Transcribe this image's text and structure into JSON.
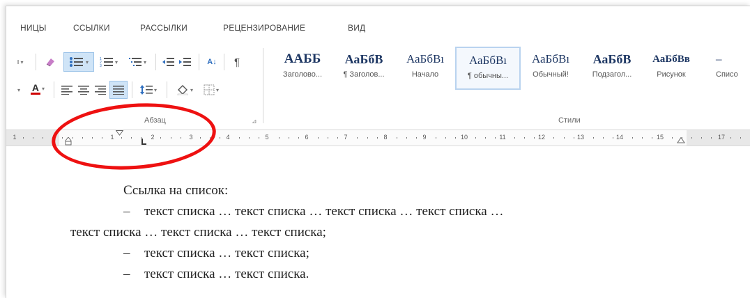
{
  "ribbon_tabs": [
    "НИЦЫ",
    "ССЫЛКИ",
    "РАССЫЛКИ",
    "РЕЦЕНЗИРОВАНИЕ",
    "ВИД"
  ],
  "paragraph_group": {
    "label": "Абзац",
    "pilcrow": "¶",
    "sort": "A↓"
  },
  "styles_group": {
    "label": "Стили",
    "items": [
      {
        "preview": "ААББ",
        "name": "Заголово..."
      },
      {
        "preview": "АаБбВ",
        "name": "¶ Заголов..."
      },
      {
        "preview": "АаБбВı",
        "name": "Начало"
      },
      {
        "preview": "АаБбВı",
        "name": "¶ обычны...",
        "selected": true
      },
      {
        "preview": "АаБбВı",
        "name": "Обычный!"
      },
      {
        "preview": "АаБбВ",
        "name": "Подзагол..."
      },
      {
        "preview": "АаБбВв",
        "name": "Рисунок"
      },
      {
        "preview": "–",
        "name": "Списо"
      }
    ]
  },
  "ruler": {
    "numbers": [
      "1",
      "1",
      "2",
      "3",
      "4",
      "5",
      "6",
      "7",
      "8",
      "9",
      "10",
      "11",
      "12",
      "13",
      "14",
      "15",
      "17"
    ]
  },
  "document": {
    "line1": "Ссылка на список:",
    "line2_dash": "–",
    "line2": "текст списка … текст списка … текст списка … текст списка …",
    "line3": "текст списка … текст списка … текст списка;",
    "line4_dash": "–",
    "line4": "текст списка … текст списка;",
    "line5_dash": "–",
    "line5": "текст списка … текст списка."
  },
  "colors": {
    "highlight_circle": "#e11111",
    "selected_style_border": "#b9d3ef",
    "font_color_underline": "#d00000"
  }
}
